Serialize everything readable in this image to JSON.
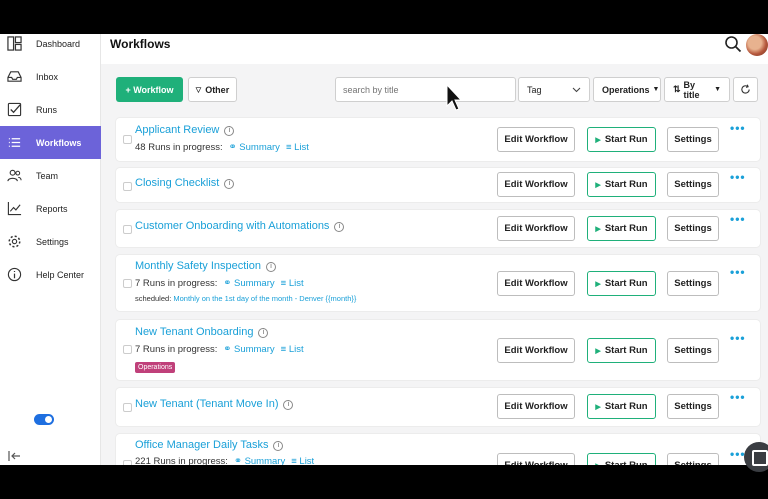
{
  "sidebar": {
    "items": [
      {
        "label": "Dashboard",
        "icon": "dashboard-icon"
      },
      {
        "label": "Inbox",
        "icon": "inbox-icon"
      },
      {
        "label": "Runs",
        "icon": "runs-icon"
      },
      {
        "label": "Workflows",
        "icon": "workflows-icon",
        "active": true
      },
      {
        "label": "Team",
        "icon": "team-icon"
      },
      {
        "label": "Reports",
        "icon": "reports-icon"
      },
      {
        "label": "Settings",
        "icon": "gear-icon"
      },
      {
        "label": "Help Center",
        "icon": "info-icon"
      }
    ],
    "toggle_on": true
  },
  "header": {
    "title": "Workflows"
  },
  "toolbar": {
    "add_label": "+ Workflow",
    "other_label": "Other",
    "search_placeholder": "search by title",
    "tag_label": "Tag",
    "operations_label": "Operations",
    "sort_label": "By title"
  },
  "row_actions": {
    "edit": "Edit Workflow",
    "start": "Start Run",
    "settings": "Settings",
    "more": "•••"
  },
  "workflows": [
    {
      "title": "Applicant Review",
      "progress": "48 Runs in progress:",
      "summary": "Summary",
      "list": "List"
    },
    {
      "title": "Closing Checklist"
    },
    {
      "title": "Customer Onboarding with Automations"
    },
    {
      "title": "Monthly Safety Inspection",
      "progress": "7 Runs in progress:",
      "summary": "Summary",
      "list": "List",
      "schedule_label": "scheduled:",
      "schedule_value": "Monthly on the 1st day of the month - Denver {{month}}"
    },
    {
      "title": "New Tenant Onboarding",
      "progress": "7 Runs in progress:",
      "summary": "Summary",
      "list": "List",
      "tag": "Operations"
    },
    {
      "title": "New Tenant (Tenant Move In)"
    },
    {
      "title": "Office Manager Daily Tasks",
      "progress": "221 Runs in progress:",
      "summary": "Summary",
      "list": "List"
    }
  ],
  "colors": {
    "accent": "#6c63d9",
    "primary": "#1fb07a",
    "link": "#1aa0d8",
    "tag": "#c0407a"
  }
}
